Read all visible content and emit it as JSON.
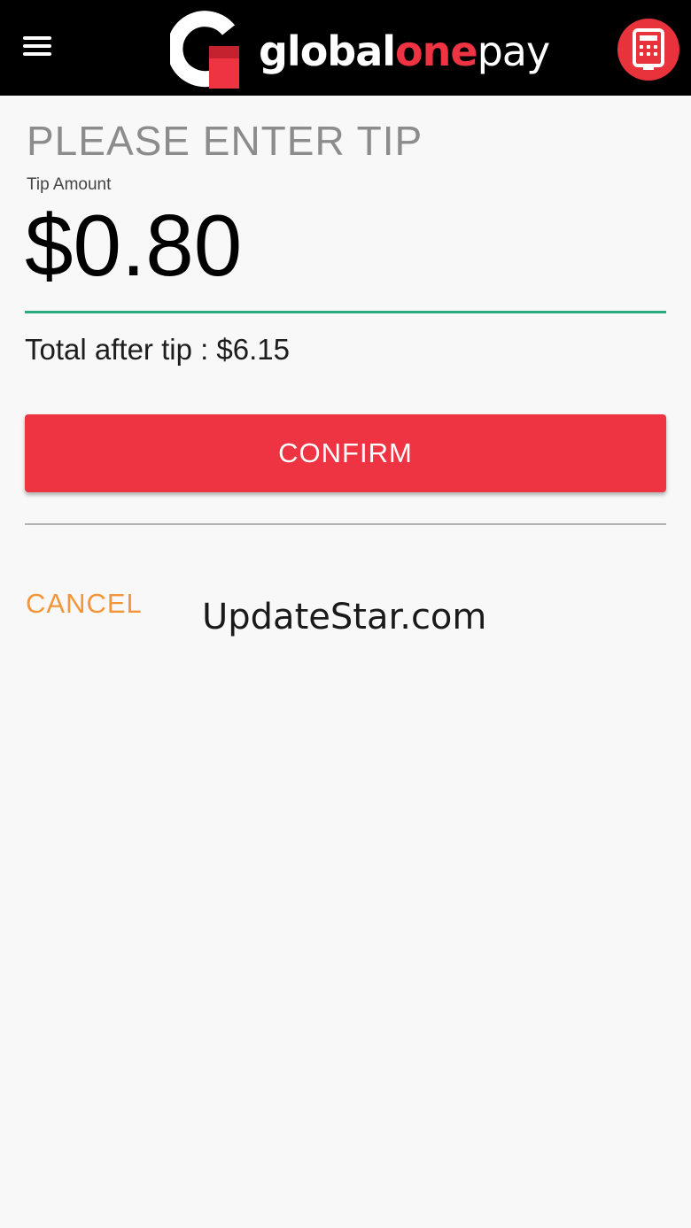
{
  "header": {
    "logo": {
      "part1": "global",
      "part2": "one",
      "part3": "pay"
    },
    "menu_icon": "hamburger-menu-icon",
    "calculator_icon": "calculator-icon"
  },
  "tip_screen": {
    "heading": "PLEASE ENTER TIP",
    "field_label": "Tip Amount",
    "amount_value": "$0.80",
    "total_text": "Total after tip : $6.15",
    "confirm_label": "CONFIRM",
    "cancel_label": "CANCEL"
  },
  "watermark": "UpdateStar.com",
  "colors": {
    "brand_red": "#ee3343",
    "accent_green": "#2aaa7f",
    "cancel_orange": "#f3963a",
    "topbar_black": "#000000"
  }
}
